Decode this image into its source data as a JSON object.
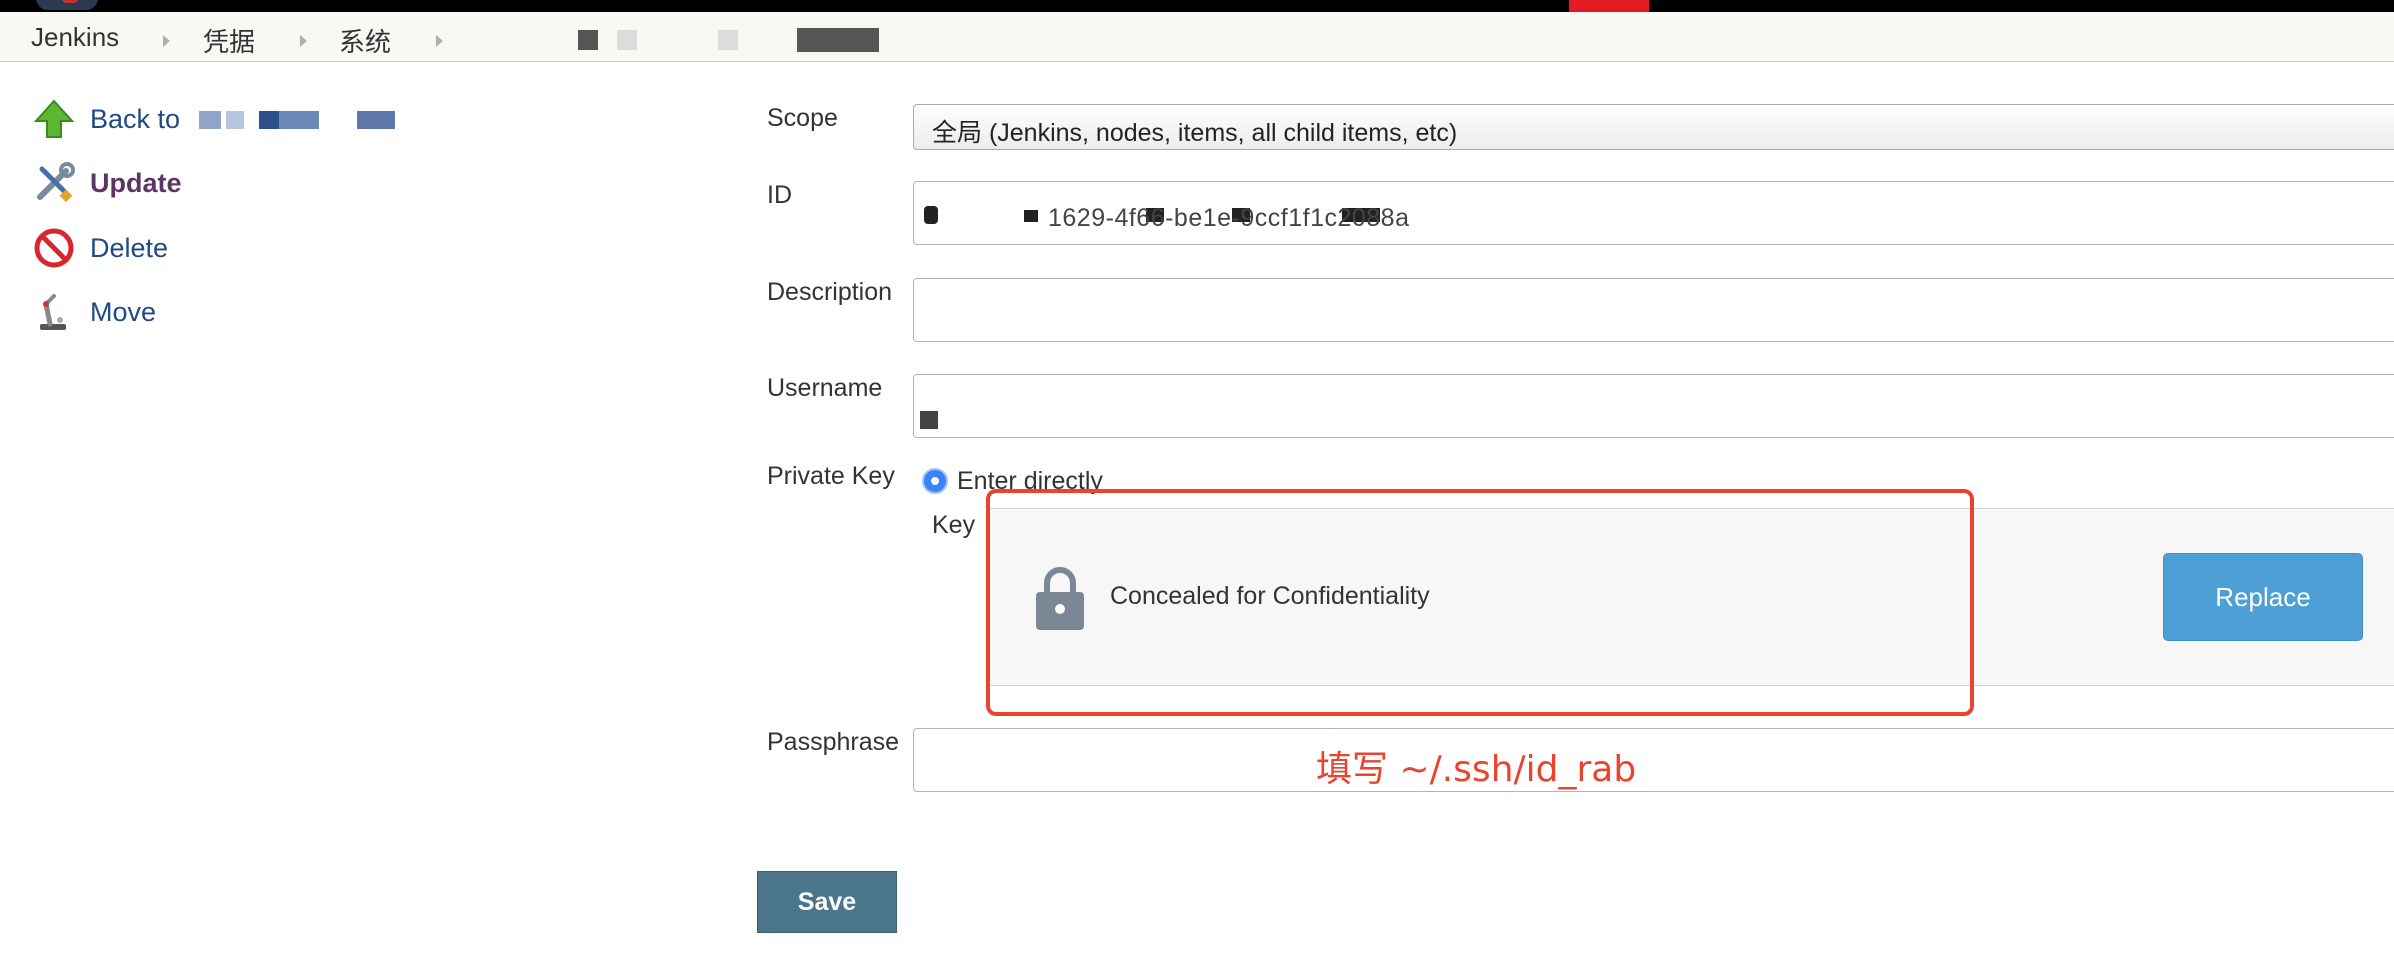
{
  "breadcrumb": {
    "items": [
      "Jenkins",
      "凭据",
      "系统"
    ]
  },
  "sidebar": {
    "back_label": "Back to",
    "update_label": "Update",
    "delete_label": "Delete",
    "move_label": "Move"
  },
  "form": {
    "scope": {
      "label": "Scope",
      "value": "全局 (Jenkins, nodes, items, all child items, etc)"
    },
    "id": {
      "label": "ID",
      "value": "1629-4f66-be1e-9ccf1f1c2088a"
    },
    "description": {
      "label": "Description",
      "value": ""
    },
    "username": {
      "label": "Username",
      "value": ""
    },
    "private_key": {
      "label": "Private Key",
      "option_label": "Enter directly",
      "key_label": "Key",
      "concealed_text": "Concealed for Confidentiality",
      "replace_label": "Replace"
    },
    "passphrase": {
      "label": "Passphrase",
      "value": ""
    },
    "save_label": "Save"
  },
  "annotation": {
    "text": "填写 ~/.ssh/id_rab",
    "color": "#e8442f"
  },
  "colors": {
    "link": "#204a87",
    "active_link": "#5c3566",
    "replace_button": "#4d9fd6",
    "save_button": "#4b758b",
    "highlight": "#e8442f"
  },
  "icons": {
    "back": "up-arrow-icon",
    "update": "wrench-screwdriver-icon",
    "delete": "no-entry-icon",
    "move": "robot-arm-icon",
    "concealed": "lock-icon"
  }
}
